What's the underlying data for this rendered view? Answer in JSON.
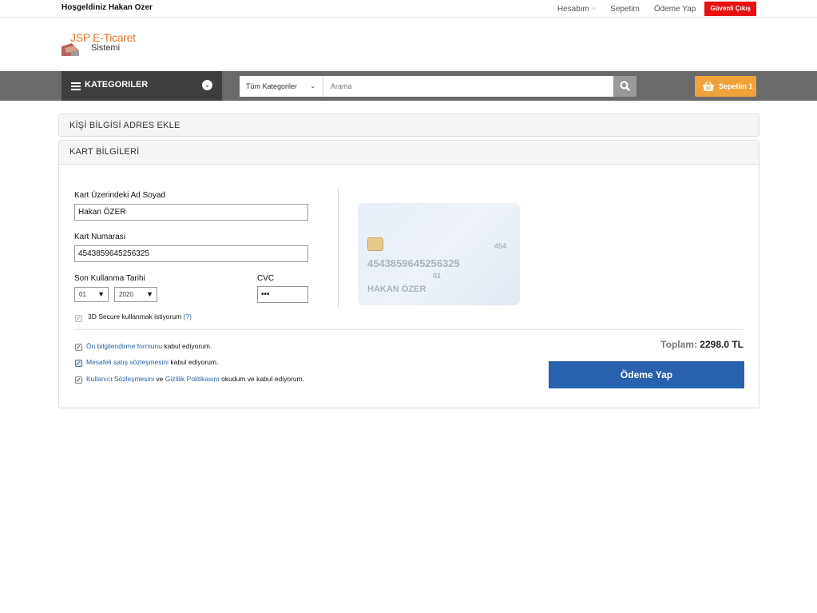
{
  "topbar": {
    "welcome": "Hoşgeldiniz Hakan Ozer",
    "links": [
      "Hesabım",
      "Sepetim",
      "Ödeme Yap"
    ],
    "secure_checkout": "Güvenli Çıkış"
  },
  "logo": {
    "line1": "JSP E-Ticaret",
    "line2": "Sistemi"
  },
  "nav": {
    "categories_label": "KATEGORILER",
    "search_category": "Tüm Kategoriler",
    "search_placeholder": "Arama",
    "cart_label": "Sepetim 1"
  },
  "panels": {
    "address": "KİŞİ BİLGİSİ ADRES EKLE",
    "card": "KART BİLGİLERİ"
  },
  "form": {
    "name_label": "Kart Üzerindeki Ad Soyad",
    "name_value": "Hakan ÖZER",
    "number_label": "Kart Numarası",
    "number_value": "4543859645256325",
    "expiry_label": "Son Kullanma Tarihi",
    "month_value": "01",
    "year_value": "2020",
    "cvc_label": "CVC",
    "cvc_value": "•••",
    "secure3d_label": "3D Secure kullanmak istiyorum",
    "secure3d_help": "(?)"
  },
  "card_preview": {
    "number": "4543859645256325",
    "cvc": "454",
    "expiry": "01",
    "name": "HAKAN ÖZER"
  },
  "agreements": {
    "a1_link": "Ön bilgilendirme formunu",
    "a1_text": " kabul ediyorum.",
    "a2_link": "Mesafeli satış sözleşmesini",
    "a2_text": " kabul ediyorum.",
    "a3_link1": "Kullanıcı Sözleşmesini",
    "a3_mid": " ve ",
    "a3_link2": "Gizlilik Politikasını",
    "a3_text": " okudum ve kabul ediyorum."
  },
  "summary": {
    "total_label": "Toplam:",
    "total_value": "2298.0 TL",
    "pay_button": "Ödeme Yap"
  },
  "colors": {
    "accent": "#2861ae",
    "cart": "#f0a23a",
    "danger": "#e81010"
  }
}
